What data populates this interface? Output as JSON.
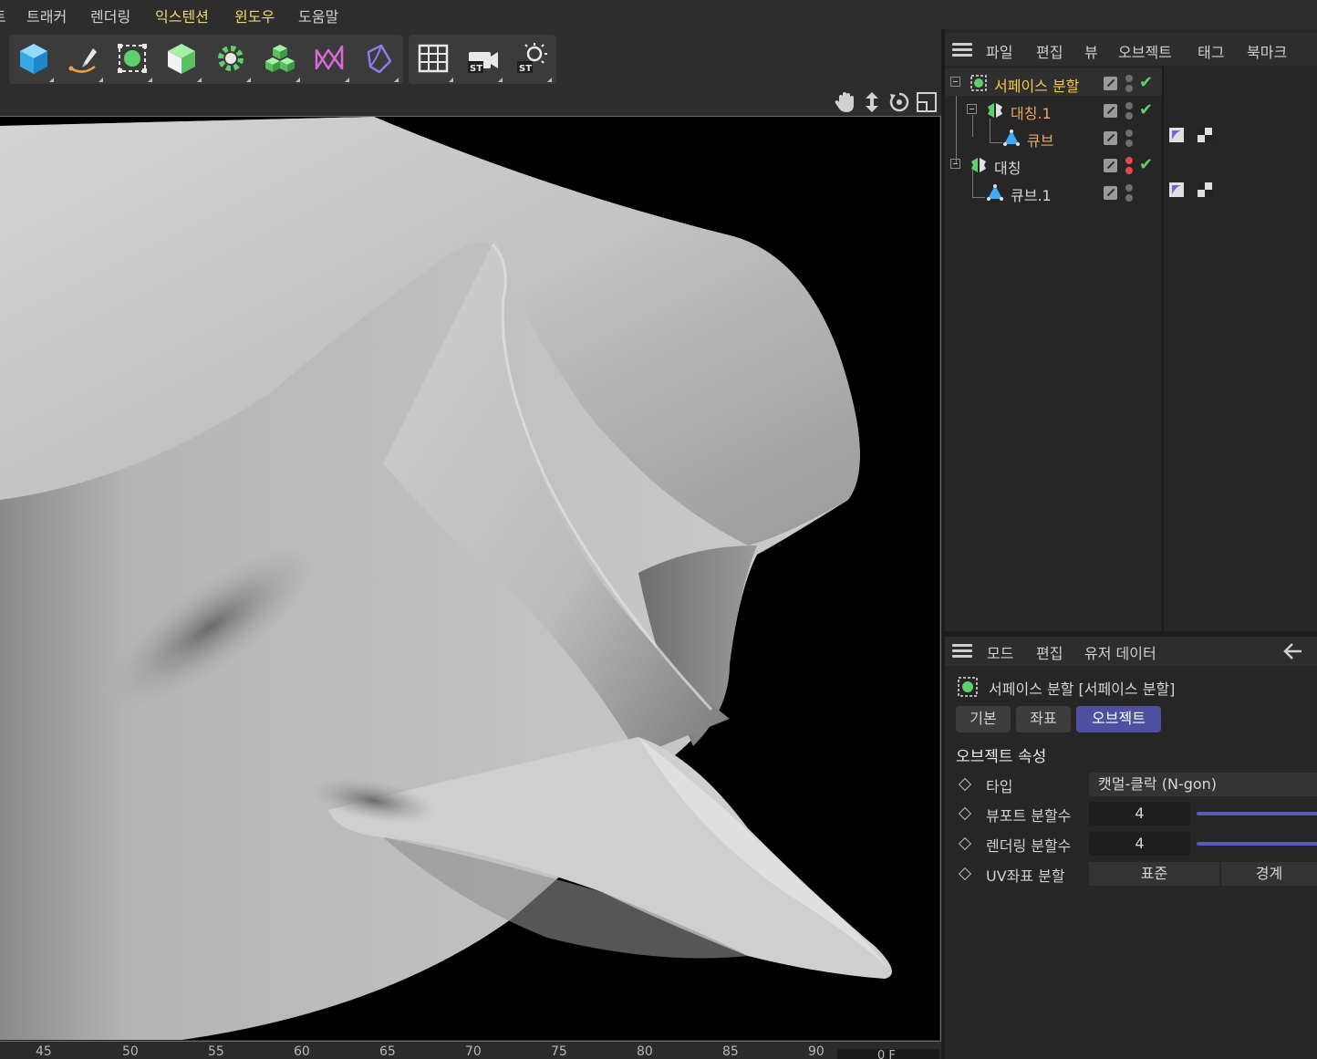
{
  "menubar": {
    "items": [
      {
        "label": "트래커",
        "highlight": false
      },
      {
        "label": "렌더링",
        "highlight": false
      },
      {
        "label": "익스텐션",
        "highlight": true
      },
      {
        "label": "윈도우",
        "highlight": true
      },
      {
        "label": "도움말",
        "highlight": false
      }
    ],
    "partial_left": "트"
  },
  "toolbar": {
    "buttons": [
      "cube-icon",
      "pen-spline-icon",
      "subdivision-surface-icon",
      "extrude-cube-icon",
      "cloner-gear-icon",
      "mograph-cubes-icon",
      "deformer-bend-icon",
      "field-icon",
      "floor-grid-icon",
      "camera-icon",
      "light-icon"
    ],
    "camera_badge": "ST",
    "light_badge": "ST"
  },
  "object_manager": {
    "menu": [
      "파일",
      "편집",
      "뷰",
      "오브젝트",
      "태그",
      "북마크"
    ],
    "objects": [
      {
        "name": "서페이스 분할",
        "color": "yellow",
        "icon": "subdivision-surface-icon",
        "status": "check"
      },
      {
        "name": "대칭.1",
        "color": "orange",
        "icon": "symmetry-icon",
        "status": "check"
      },
      {
        "name": "큐브",
        "color": "orange",
        "icon": "polygon-object-icon",
        "status": "none"
      },
      {
        "name": "대칭",
        "color": "white",
        "icon": "symmetry-icon",
        "status": "check"
      },
      {
        "name": "큐브.1",
        "color": "white",
        "icon": "polygon-object-icon",
        "status": "none"
      }
    ]
  },
  "attribute_manager": {
    "menu": [
      "모드",
      "편집",
      "유저 데이터"
    ],
    "title": "서페이스 분할 [서페이스 분할]",
    "tabs": [
      {
        "label": "기본",
        "active": false
      },
      {
        "label": "좌표",
        "active": false
      },
      {
        "label": "오브젝트",
        "active": true
      }
    ],
    "section_title": "오브젝트 속성",
    "properties": {
      "type_label": "타입",
      "type_value": "캣멀-클락 (N-gon)",
      "viewport_label": "뷰포트 분할수",
      "viewport_value": "4",
      "render_label": "렌더링 분할수",
      "render_value": "4",
      "uv_label": "UV좌표 분할",
      "uv_options": [
        "표준",
        "경계"
      ]
    }
  },
  "timeline": {
    "ticks": [
      "45",
      "50",
      "55",
      "60",
      "65",
      "70",
      "75",
      "80",
      "85",
      "90"
    ],
    "field_value": "0 F"
  },
  "colors": {
    "accent": "#4e4f9e",
    "highlight_menu": "#f2d86a",
    "active_object": "#f2c64a",
    "child_object": "#f0a35e",
    "check": "#5fd06b"
  }
}
